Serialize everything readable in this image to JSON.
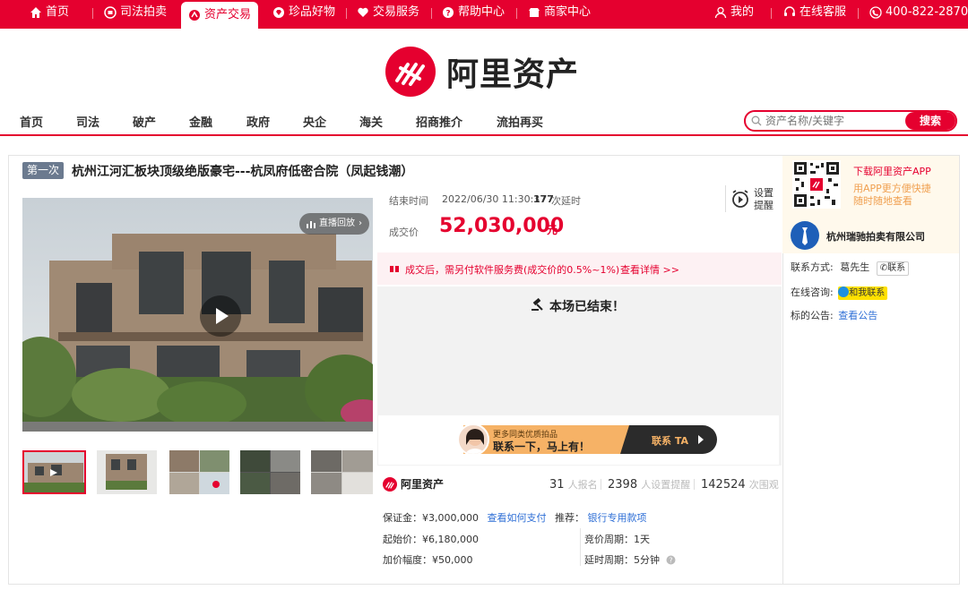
{
  "topbar": {
    "home": "首页",
    "judicial": "司法拍卖",
    "asset": "资产交易",
    "treasure": "珍品好物",
    "trade_service": "交易服务",
    "help": "帮助中心",
    "merchant": "商家中心",
    "mine": "我的",
    "service": "在线客服",
    "phone": "400-822-2870"
  },
  "logo": {
    "text": "阿里资产"
  },
  "nav": {
    "items": [
      "首页",
      "司法",
      "破产",
      "金融",
      "政府",
      "央企",
      "海关",
      "招商推介",
      "流拍再买"
    ]
  },
  "search": {
    "placeholder": "资产名称/关键字",
    "button": "搜索"
  },
  "lot": {
    "badge": "第一次",
    "title": "杭州江河汇板块顶级绝版豪宅---杭凤府低密合院（凤起钱潮）",
    "replay": "直播回放",
    "end_label": "结束时间",
    "end_time": "2022/06/30 11:30:37",
    "delay_count": "177",
    "delay_label": "次延时",
    "reminder_line1": "设置",
    "reminder_line2": "提醒",
    "deal_label": "成交价",
    "deal_price": "52,030,000",
    "deal_unit": "元",
    "fee_text": "成交后，需另付软件服务费(成交价的0.5%~1%)",
    "fee_link": "查看详情 >>",
    "ended_text": "本场已结束！",
    "banner_line1": "更多同类优质拍品",
    "banner_line2": "联系一下，马上有！",
    "banner_button": "联系 TA",
    "brand": "阿里资产",
    "signups": "31",
    "signups_label": "人报名",
    "reminders": "2398",
    "reminders_label": "人设置提醒",
    "views": "142524",
    "views_label": "次围观",
    "deposit_label": "保证金：",
    "deposit_value": "¥3,000,000",
    "how_pay": "查看如何支付",
    "recommend_label": "推荐：",
    "bank_link": "银行专用款项",
    "start_label": "起始价：",
    "start_value": "¥6,180,000",
    "period_label": "竞价周期：",
    "period_value": "1天",
    "increment_label": "加价幅度：",
    "increment_value": "¥50,000",
    "extend_label": "延时周期：",
    "extend_value": "5分钟"
  },
  "side": {
    "app_title": "下载阿里资产APP",
    "app_sub1": "用APP更方便快捷",
    "app_sub2": "随时随地查看",
    "company": "杭州瑞驰拍卖有限公司",
    "contact_label": "联系方式:",
    "contact_name": "葛先生",
    "contact_button": "联系",
    "consult_label": "在线咨询:",
    "consult_button": "和我联系",
    "notice_label": "标的公告:",
    "notice_link": "查看公告"
  },
  "colors": {
    "brand": "#e5002f",
    "link": "#2f6fd6"
  }
}
